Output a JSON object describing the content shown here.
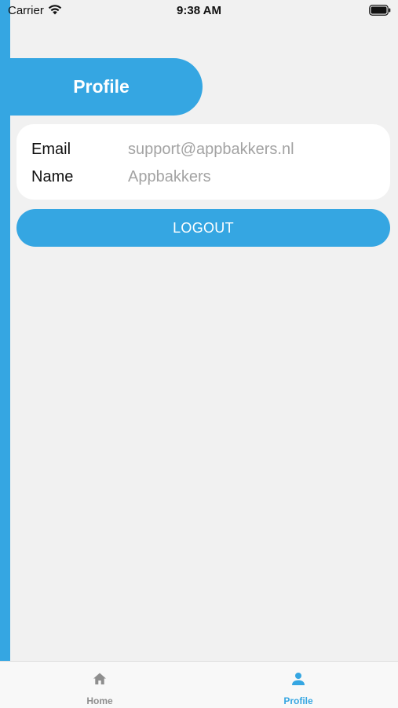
{
  "status_bar": {
    "carrier": "Carrier",
    "time": "9:38 AM"
  },
  "header": {
    "title": "Profile"
  },
  "profile": {
    "email_label": "Email",
    "email_value": "support@appbakkers.nl",
    "name_label": "Name",
    "name_value": "Appbakkers"
  },
  "actions": {
    "logout_label": "LOGOUT"
  },
  "tab_bar": {
    "tabs": [
      {
        "label": "Home",
        "icon": "home-icon",
        "active": false
      },
      {
        "label": "Profile",
        "icon": "person-icon",
        "active": true
      }
    ]
  },
  "colors": {
    "accent": "#35a6e2",
    "background": "#f1f1f1",
    "card": "#ffffff",
    "value_text": "#a3a3a3",
    "inactive_tab": "#8e8e8e"
  }
}
